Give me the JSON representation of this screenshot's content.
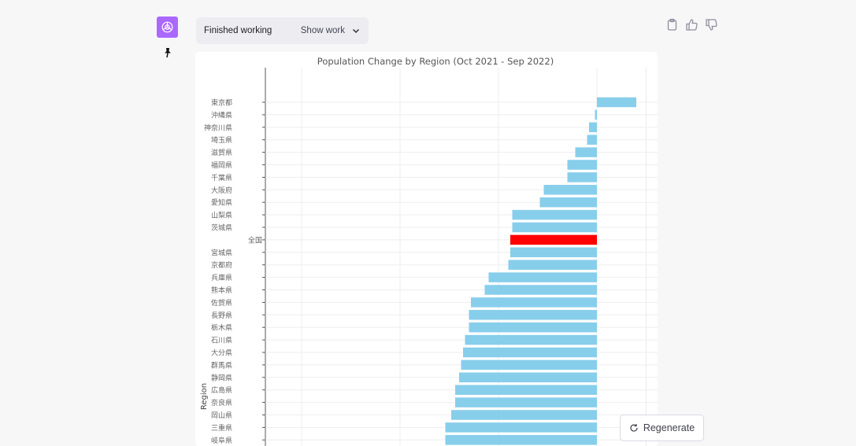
{
  "status": {
    "label": "Finished working",
    "show_work": "Show work"
  },
  "buttons": {
    "regenerate": "Regenerate"
  },
  "icons": {
    "avatar": "openai-logo-icon",
    "pin": "pin-icon",
    "copy": "clipboard-icon",
    "like": "thumbs-up-icon",
    "dislike": "thumbs-down-icon",
    "regenerate": "refresh-icon",
    "chevron": "chevron-down-icon"
  },
  "colors": {
    "avatar_bg": "#ab68ff",
    "bar": "#87ceeb",
    "highlight": "#ff0000"
  },
  "chart_data": {
    "type": "bar",
    "orientation": "horizontal",
    "title": "Population Change by Region (Oct 2021 - Sep 2022)",
    "ylabel": "Region",
    "categories": [
      "東京都",
      "沖縄県",
      "神奈川県",
      "埼玉県",
      "滋賀県",
      "福岡県",
      "千葉県",
      "大阪府",
      "愛知県",
      "山梨県",
      "茨城県",
      "全国",
      "宮城県",
      "京都府",
      "兵庫県",
      "熊本県",
      "佐賀県",
      "長野県",
      "栃木県",
      "石川県",
      "大分県",
      "群馬県",
      "静岡県",
      "広島県",
      "奈良県",
      "岡山県",
      "三重県",
      "岐阜県"
    ],
    "values": [
      0.2,
      -0.01,
      -0.04,
      -0.05,
      -0.11,
      -0.15,
      -0.15,
      -0.27,
      -0.29,
      -0.43,
      -0.43,
      -0.44,
      -0.44,
      -0.45,
      -0.55,
      -0.57,
      -0.64,
      -0.65,
      -0.65,
      -0.67,
      -0.68,
      -0.69,
      -0.7,
      -0.72,
      -0.72,
      -0.74,
      -0.77,
      -0.77
    ],
    "highlight_category": "全国",
    "grid": true,
    "legend": "none"
  }
}
